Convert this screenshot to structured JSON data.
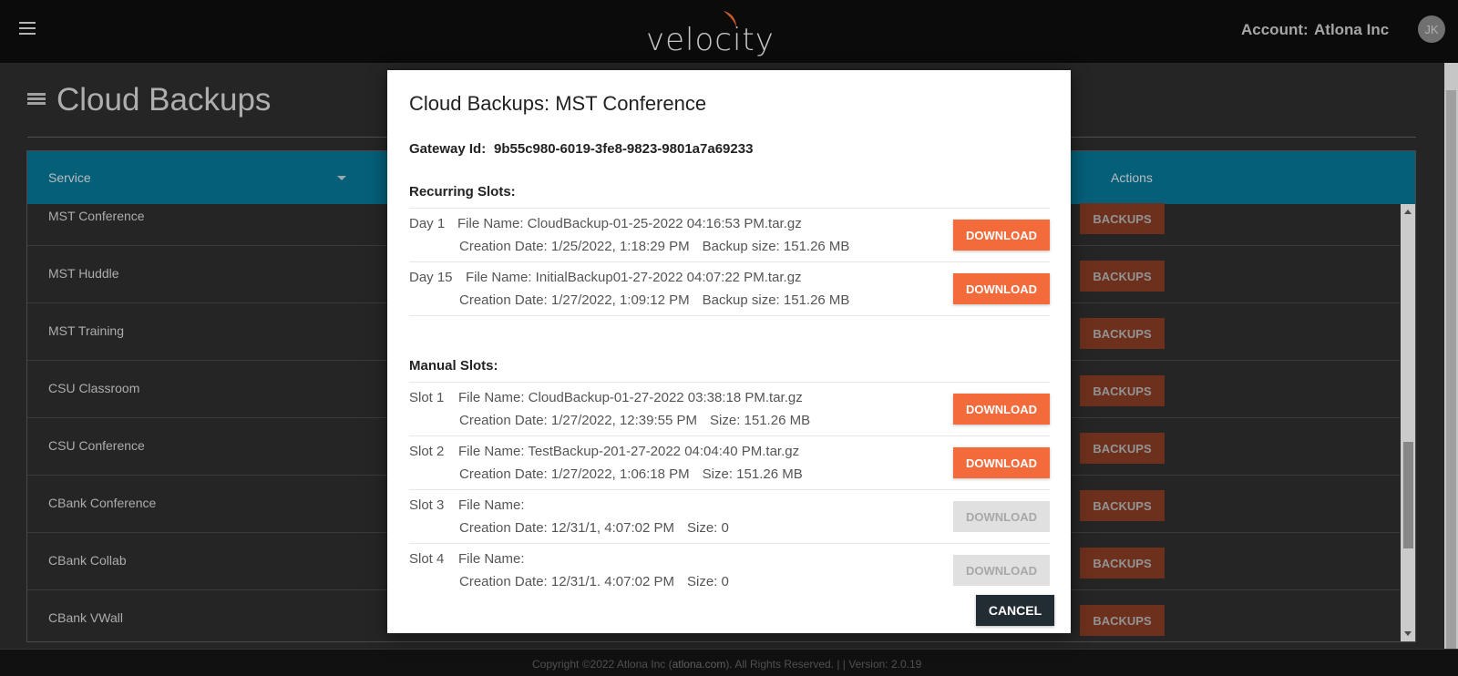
{
  "header": {
    "logo_text": "velocity",
    "account_label": "Account:",
    "account_name": "Atlona Inc",
    "avatar_initials": "JK"
  },
  "page": {
    "title": "Cloud Backups"
  },
  "table": {
    "columns": {
      "service": "Service",
      "actions": "Actions"
    },
    "rows": [
      {
        "name": "MST Conference",
        "action": "BACKUPS"
      },
      {
        "name": "MST Huddle",
        "action": "BACKUPS"
      },
      {
        "name": "MST Training",
        "action": "BACKUPS"
      },
      {
        "name": "CSU Classroom",
        "action": "BACKUPS"
      },
      {
        "name": "CSU Conference",
        "action": "BACKUPS"
      },
      {
        "name": "CBank Conference",
        "action": "BACKUPS"
      },
      {
        "name": "CBank Collab",
        "action": "BACKUPS"
      },
      {
        "name": "CBank VWall",
        "action": "BACKUPS"
      }
    ]
  },
  "footer": {
    "prefix": "Copyright ©2022 Atlona Inc (",
    "link": "atlona.com",
    "suffix": "). All Rights Reserved. | | Version: 2.0.19"
  },
  "modal": {
    "title": "Cloud Backups: MST Conference",
    "gateway_label": "Gateway Id:",
    "gateway_id": "9b55c980-6019-3fe8-9823-9801a7a69233",
    "recurring_title": "Recurring Slots:",
    "manual_title": "Manual Slots:",
    "recurring": [
      {
        "label": "Day 1",
        "file": "File Name: CloudBackup-01-25-2022 04:16:53 PM.tar.gz",
        "date": "Creation Date: 1/25/2022, 1:18:29 PM",
        "size": "Backup size: 151.26 MB",
        "button": "DOWNLOAD",
        "enabled": true
      },
      {
        "label": "Day 15",
        "file": "File Name: InitialBackup01-27-2022 04:07:22 PM.tar.gz",
        "date": "Creation Date: 1/27/2022, 1:09:12 PM",
        "size": "Backup size: 151.26 MB",
        "button": "DOWNLOAD",
        "enabled": true
      }
    ],
    "manual": [
      {
        "label": "Slot 1",
        "file": "File Name: CloudBackup-01-27-2022 03:38:18 PM.tar.gz",
        "date": "Creation Date: 1/27/2022, 12:39:55 PM",
        "size": "Size: 151.26 MB",
        "button": "DOWNLOAD",
        "enabled": true
      },
      {
        "label": "Slot 2",
        "file": "File Name: TestBackup-201-27-2022 04:04:40 PM.tar.gz",
        "date": "Creation Date: 1/27/2022, 1:06:18 PM",
        "size": "Size: 151.26 MB",
        "button": "DOWNLOAD",
        "enabled": true
      },
      {
        "label": "Slot 3",
        "file": "File Name:",
        "date": "Creation Date: 12/31/1, 4:07:02 PM",
        "size": "Size: 0",
        "button": "DOWNLOAD",
        "enabled": false
      },
      {
        "label": "Slot 4",
        "file": "File Name:",
        "date": "Creation Date: 12/31/1. 4:07:02 PM",
        "size": "Size: 0",
        "button": "DOWNLOAD",
        "enabled": false
      }
    ],
    "cancel_label": "CANCEL"
  },
  "colors": {
    "download_enabled": "#f36b3b",
    "download_disabled": "#e0e0e0",
    "backups_button": "#7b3720",
    "table_header": "#066d8a",
    "cancel_button": "#222c33",
    "logo_accent": "#e8692f"
  },
  "icons": {
    "menu": "hamburger-menu-icon",
    "page": "list-icon",
    "sort": "caret-down-icon"
  }
}
